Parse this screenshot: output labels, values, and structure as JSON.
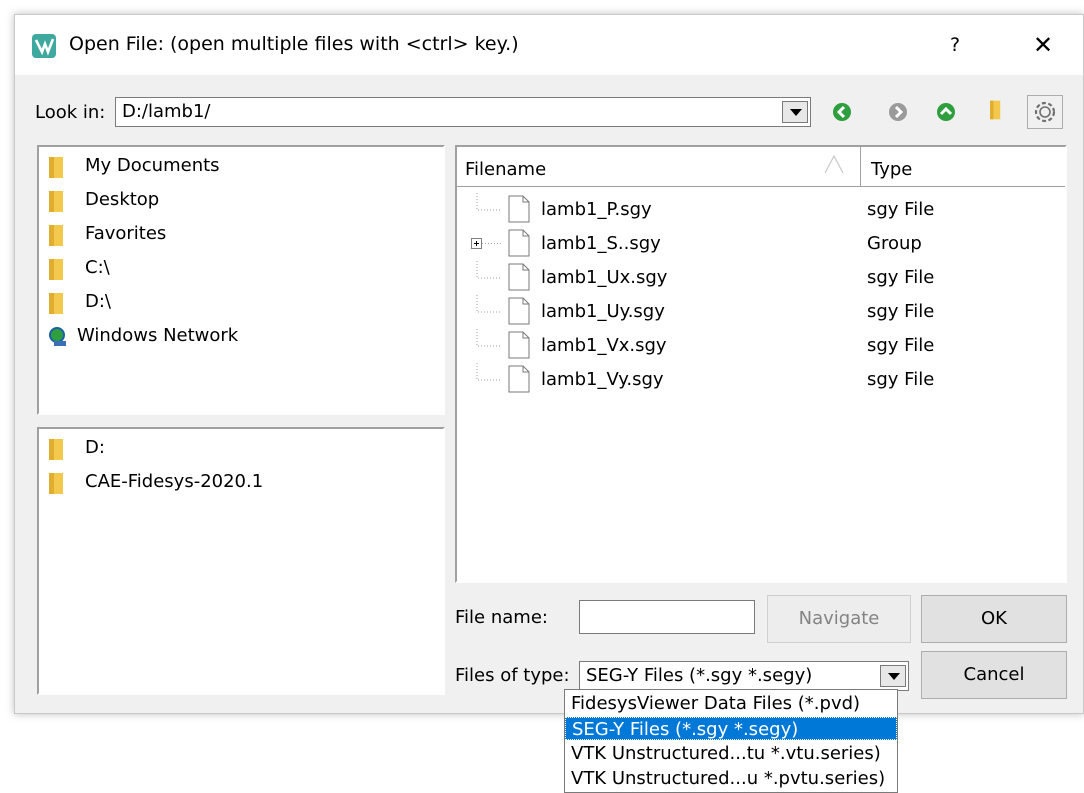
{
  "window": {
    "title": "Open File:  (open multiple files with <ctrl> key.)",
    "help": "?",
    "close": "✕"
  },
  "toolbar": {
    "look_in_label": "Look in:",
    "look_in_value": "D:/lamb1/",
    "icons": [
      "back-icon",
      "forward-icon",
      "up-icon",
      "new-folder-icon",
      "settings-icon"
    ]
  },
  "places": [
    {
      "label": "My Documents",
      "icon": "folder-icon"
    },
    {
      "label": "Desktop",
      "icon": "folder-icon"
    },
    {
      "label": "Favorites",
      "icon": "folder-icon"
    },
    {
      "label": "C:\\",
      "icon": "folder-icon"
    },
    {
      "label": "D:\\",
      "icon": "folder-icon"
    },
    {
      "label": "Windows Network",
      "icon": "network-icon"
    }
  ],
  "recent": [
    {
      "label": "D:",
      "icon": "folder-icon"
    },
    {
      "label": "CAE-Fidesys-2020.1",
      "icon": "folder-icon"
    }
  ],
  "files": {
    "headers": {
      "filename": "Filename",
      "type": "Type"
    },
    "rows": [
      {
        "name": "lamb1_P.sgy",
        "type": "sgy File",
        "expandable": false
      },
      {
        "name": "lamb1_S..sgy",
        "type": "Group",
        "expandable": true
      },
      {
        "name": "lamb1_Ux.sgy",
        "type": "sgy File",
        "expandable": false
      },
      {
        "name": "lamb1_Uy.sgy",
        "type": "sgy File",
        "expandable": false
      },
      {
        "name": "lamb1_Vx.sgy",
        "type": "sgy File",
        "expandable": false
      },
      {
        "name": "lamb1_Vy.sgy",
        "type": "sgy File",
        "expandable": false
      }
    ]
  },
  "form": {
    "file_name_label": "File name:",
    "file_name_value": "",
    "navigate_label": "Navigate",
    "ok_label": "OK",
    "files_of_type_label": "Files of type:",
    "files_of_type_value": "SEG-Y Files (*.sgy *.segy)",
    "cancel_label": "Cancel"
  },
  "type_dropdown": {
    "options": [
      "FidesysViewer Data Files (*.pvd)",
      "SEG-Y Files (*.sgy *.segy)",
      "VTK Unstructured...tu *.vtu.series)",
      "VTK Unstructured...u *.pvtu.series)"
    ],
    "selected_index": 1
  },
  "colors": {
    "accent": "#0078d7",
    "folder": "#f2c94c",
    "nav_green": "#2e9e3e"
  }
}
